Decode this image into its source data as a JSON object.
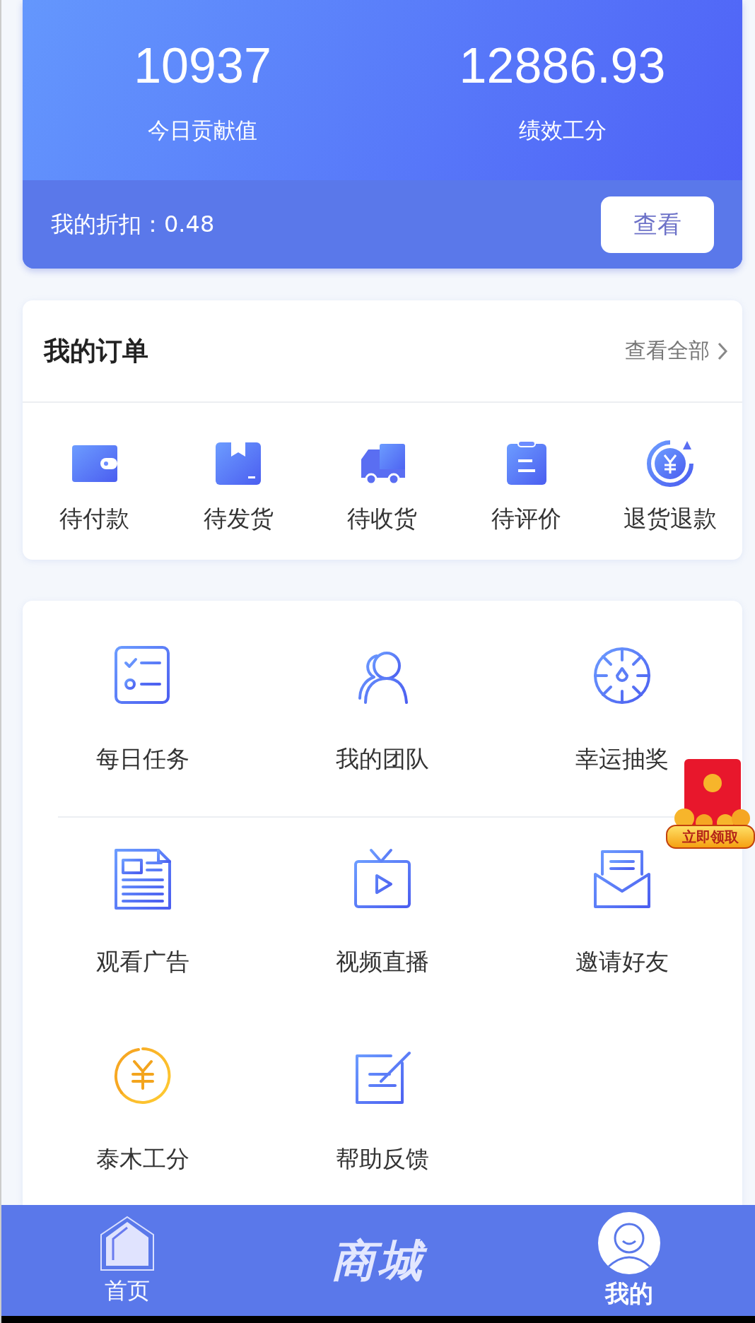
{
  "stats": [
    {
      "value": "10937",
      "label": "今日贡献值"
    },
    {
      "value": "12886.93",
      "label": "绩效工分"
    }
  ],
  "discount": {
    "text": "我的折扣：0.48",
    "button": "查看"
  },
  "orders": {
    "title": "我的订单",
    "view_all": "查看全部",
    "items": [
      {
        "label": "待付款"
      },
      {
        "label": "待发货"
      },
      {
        "label": "待收货"
      },
      {
        "label": "待评价"
      },
      {
        "label": "退货退款"
      }
    ]
  },
  "services": {
    "rows": [
      [
        {
          "label": "每日任务"
        },
        {
          "label": "我的团队"
        },
        {
          "label": "幸运抽奖"
        }
      ],
      [
        {
          "label": "观看广告"
        },
        {
          "label": "视频直播"
        },
        {
          "label": "邀请好友"
        }
      ],
      [
        {
          "label": "泰木工分"
        },
        {
          "label": "帮助反馈"
        }
      ]
    ]
  },
  "floating_badge": {
    "label": "立即领取"
  },
  "tab_bar": [
    {
      "label": "首页",
      "selected": false
    },
    {
      "label": "商城",
      "selected": false
    },
    {
      "label": "我的",
      "selected": true
    }
  ]
}
